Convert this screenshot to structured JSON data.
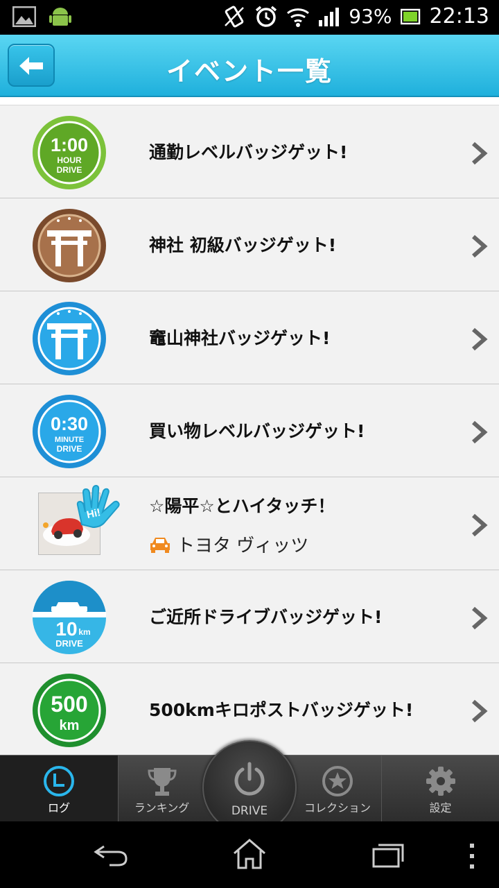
{
  "status_bar": {
    "battery": "93%",
    "time": "22:13",
    "icons": [
      "gallery-icon",
      "android-icon",
      "vibrate-icon",
      "alarm-icon",
      "wifi-icon",
      "signal-icon",
      "battery-icon"
    ]
  },
  "header": {
    "title": "イベント一覧",
    "back_icon": "back-arrow-icon",
    "color": "#22b4de"
  },
  "events": [
    {
      "label": "通勤レベルバッジゲット!",
      "badge": "1:00 HOUR DRIVE badge",
      "badge_lines": [
        "1:00",
        "HOUR",
        "DRIVE"
      ]
    },
    {
      "label": "神社 初級バッジゲット!",
      "badge": "bronze torii badge"
    },
    {
      "label": "竈山神社バッジゲット!",
      "badge": "blue torii badge"
    },
    {
      "label": "買い物レベルバッジゲット!",
      "badge": "0:30 MINUTE DRIVE badge",
      "badge_lines": [
        "0:30",
        "MINUTE",
        "DRIVE"
      ]
    },
    {
      "label": "☆陽平☆とハイタッチ！",
      "sub": "トヨタ ヴィッツ",
      "badge": "hi-five photo",
      "hi": "Hi!"
    },
    {
      "label": "ご近所ドライブバッジゲット!",
      "badge": "10km DRIVE badge",
      "badge_lines": [
        "10",
        "km",
        "DRIVE"
      ]
    },
    {
      "label": "500kmキロポストバッジゲット!",
      "badge": "500 km badge",
      "badge_lines": [
        "500",
        "km"
      ]
    }
  ],
  "tabs": [
    {
      "label": "ログ",
      "icon": "clock-icon",
      "active": true
    },
    {
      "label": "ランキング",
      "icon": "trophy-icon"
    },
    {
      "label": "DRIVE",
      "icon": "power-icon"
    },
    {
      "label": "コレクション",
      "icon": "star-icon"
    },
    {
      "label": "設定",
      "icon": "gear-icon"
    }
  ],
  "nav": {
    "icons": [
      "back-nav-icon",
      "home-nav-icon",
      "recents-nav-icon",
      "menu-nav-icon"
    ]
  }
}
